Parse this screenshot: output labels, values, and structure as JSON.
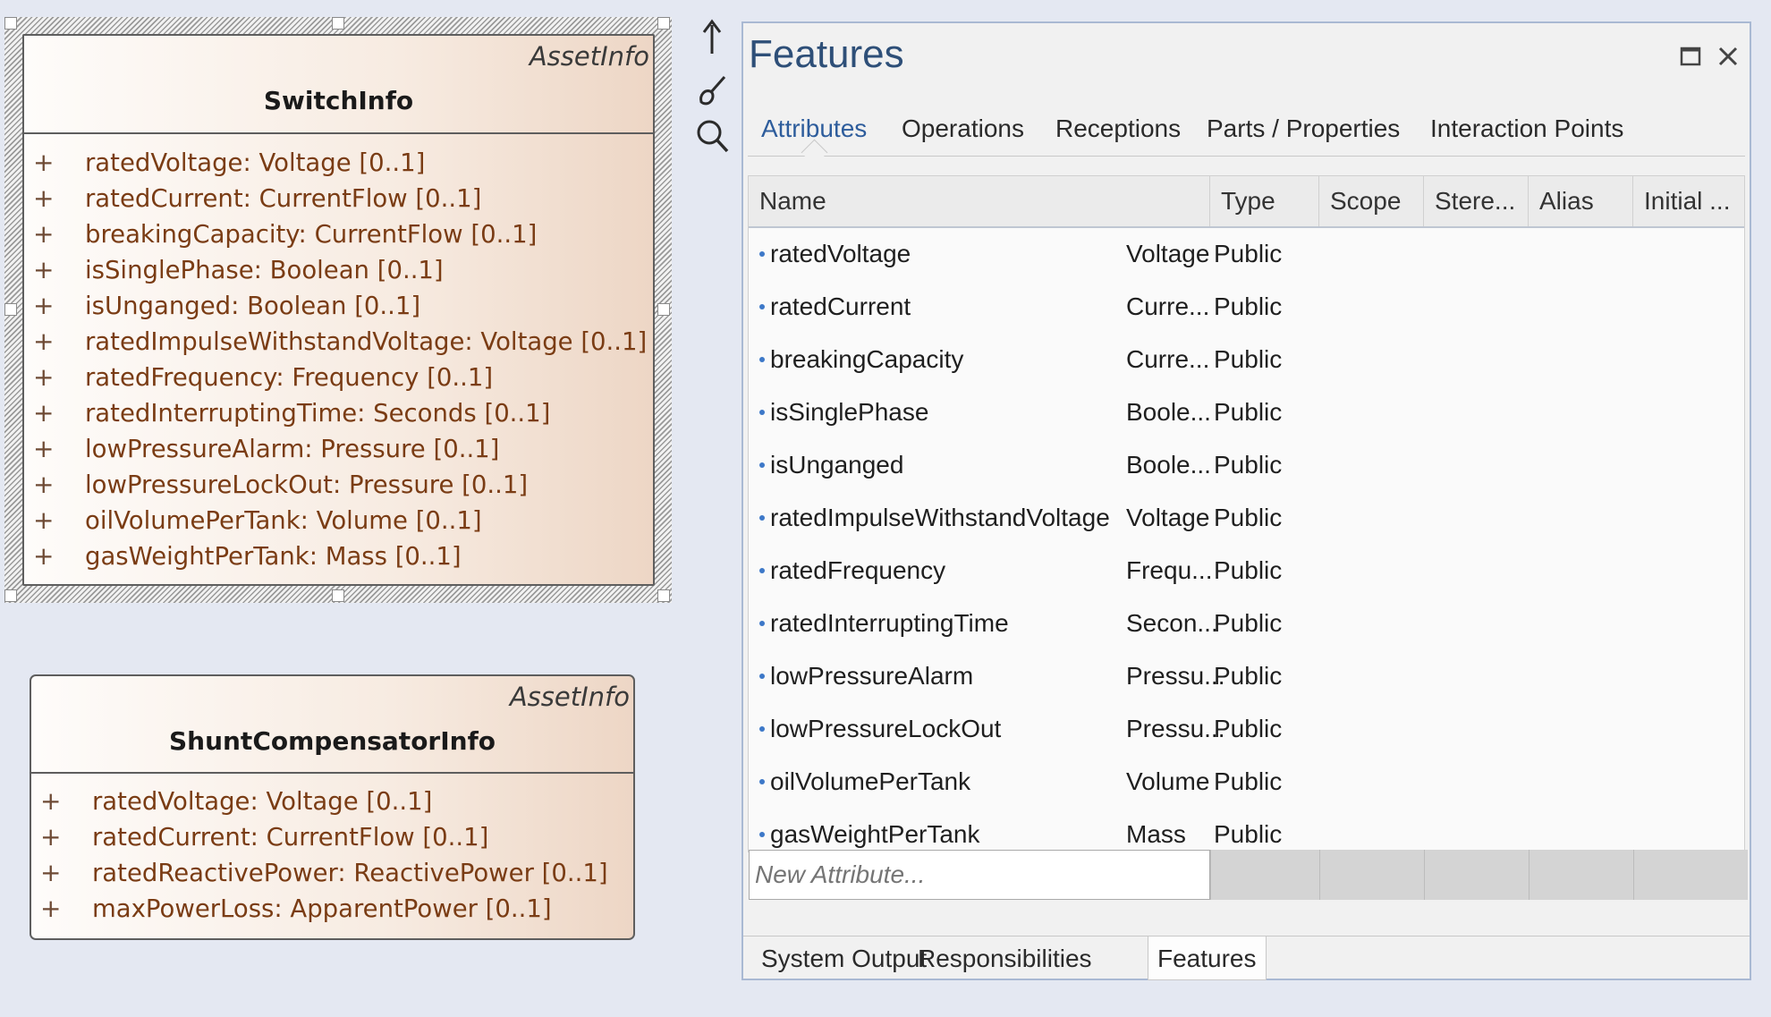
{
  "diagram": {
    "switch_info": {
      "stereotype": "AssetInfo",
      "name": "SwitchInfo",
      "attributes": [
        "ratedVoltage: Voltage [0..1]",
        "ratedCurrent: CurrentFlow [0..1]",
        "breakingCapacity: CurrentFlow [0..1]",
        "isSinglePhase: Boolean [0..1]",
        "isUnganged: Boolean [0..1]",
        "ratedImpulseWithstandVoltage: Voltage [0..1]",
        "ratedFrequency: Frequency [0..1]",
        "ratedInterruptingTime: Seconds [0..1]",
        "lowPressureAlarm: Pressure [0..1]",
        "lowPressureLockOut: Pressure [0..1]",
        "oilVolumePerTank: Volume [0..1]",
        "gasWeightPerTank: Mass [0..1]"
      ]
    },
    "shunt_info": {
      "stereotype": "AssetInfo",
      "name": "ShuntCompensatorInfo",
      "attributes": [
        "ratedVoltage: Voltage [0..1]",
        "ratedCurrent: CurrentFlow [0..1]",
        "ratedReactivePower: ReactivePower [0..1]",
        "maxPowerLoss: ApparentPower [0..1]"
      ]
    },
    "visibility_symbol": "+"
  },
  "toolbar": {
    "icons": [
      "up-arrow-icon",
      "paintbrush-icon",
      "magnifier-icon"
    ]
  },
  "features": {
    "title": "Features",
    "tabs": [
      "Attributes",
      "Operations",
      "Receptions",
      "Parts / Properties",
      "Interaction Points"
    ],
    "active_tab": "Attributes",
    "columns": [
      "Name",
      "Type",
      "Scope",
      "Stere...",
      "Alias",
      "Initial ..."
    ],
    "rows": [
      {
        "name": "ratedVoltage",
        "type": "Voltage",
        "scope": "Public"
      },
      {
        "name": "ratedCurrent",
        "type": "Curre...",
        "scope": "Public"
      },
      {
        "name": "breakingCapacity",
        "type": "Curre...",
        "scope": "Public"
      },
      {
        "name": "isSinglePhase",
        "type": "Boole...",
        "scope": "Public"
      },
      {
        "name": "isUnganged",
        "type": "Boole...",
        "scope": "Public"
      },
      {
        "name": "ratedImpulseWithstandVoltage",
        "type": "Voltage",
        "scope": "Public"
      },
      {
        "name": "ratedFrequency",
        "type": "Frequ...",
        "scope": "Public"
      },
      {
        "name": "ratedInterruptingTime",
        "type": "Secon...",
        "scope": "Public"
      },
      {
        "name": "lowPressureAlarm",
        "type": "Pressu...",
        "scope": "Public"
      },
      {
        "name": "lowPressureLockOut",
        "type": "Pressu...",
        "scope": "Public"
      },
      {
        "name": "oilVolumePerTank",
        "type": "Volume",
        "scope": "Public"
      },
      {
        "name": "gasWeightPerTank",
        "type": "Mass",
        "scope": "Public"
      }
    ],
    "new_attribute_placeholder": "New Attribute...",
    "bottom_tabs": [
      "System Output",
      "Responsibilities",
      "Features"
    ],
    "active_bottom_tab": "Features"
  },
  "colors": {
    "title_blue": "#2e4f78",
    "active_tab_blue": "#2e5d9c",
    "attribute_text": "#7a3c14"
  }
}
